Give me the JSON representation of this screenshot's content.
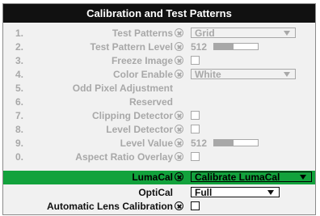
{
  "window": {
    "title": "Calibration and Test Patterns"
  },
  "rows": [
    {
      "num": "1.",
      "label": "Test Patterns",
      "control": "select",
      "value": "Grid",
      "state": "disabled"
    },
    {
      "num": "2.",
      "label": "Test Pattern Level",
      "control": "level",
      "value": "512",
      "fill": 0.45,
      "state": "disabled"
    },
    {
      "num": "3.",
      "label": "Freeze Image",
      "control": "checkbox",
      "state": "disabled"
    },
    {
      "num": "4.",
      "label": "Color Enable",
      "control": "select",
      "value": "White",
      "state": "disabled"
    },
    {
      "num": "5.",
      "label": "Odd Pixel Adjustment",
      "control": "none",
      "state": "disabled"
    },
    {
      "num": "6.",
      "label": "Reserved",
      "control": "none",
      "state": "disabled"
    },
    {
      "num": "7.",
      "label": "Clipping Detector",
      "control": "checkbox",
      "state": "disabled"
    },
    {
      "num": "8.",
      "label": "Level Detector",
      "control": "checkbox",
      "state": "disabled"
    },
    {
      "num": "9.",
      "label": "Level Value",
      "control": "level",
      "value": "512",
      "fill": 0.45,
      "state": "disabled"
    },
    {
      "num": "0.",
      "label": "Aspect Ratio Overlay",
      "control": "checkbox",
      "state": "disabled"
    },
    {
      "num": "",
      "label": "LumaCal",
      "control": "select",
      "value": "Calibrate LumaCal",
      "state": "selected"
    },
    {
      "num": "",
      "label": "OptiCal",
      "control": "select",
      "value": "Full",
      "state": "active"
    },
    {
      "num": "",
      "label": "Automatic Lens Calibration",
      "control": "checkbox",
      "state": "active"
    }
  ],
  "colors": {
    "selected_highlight": "#12a23c",
    "disabled_text": "#a8a8a8",
    "title_bar": "#111111"
  },
  "icons": {
    "lock": "lock-icon"
  }
}
